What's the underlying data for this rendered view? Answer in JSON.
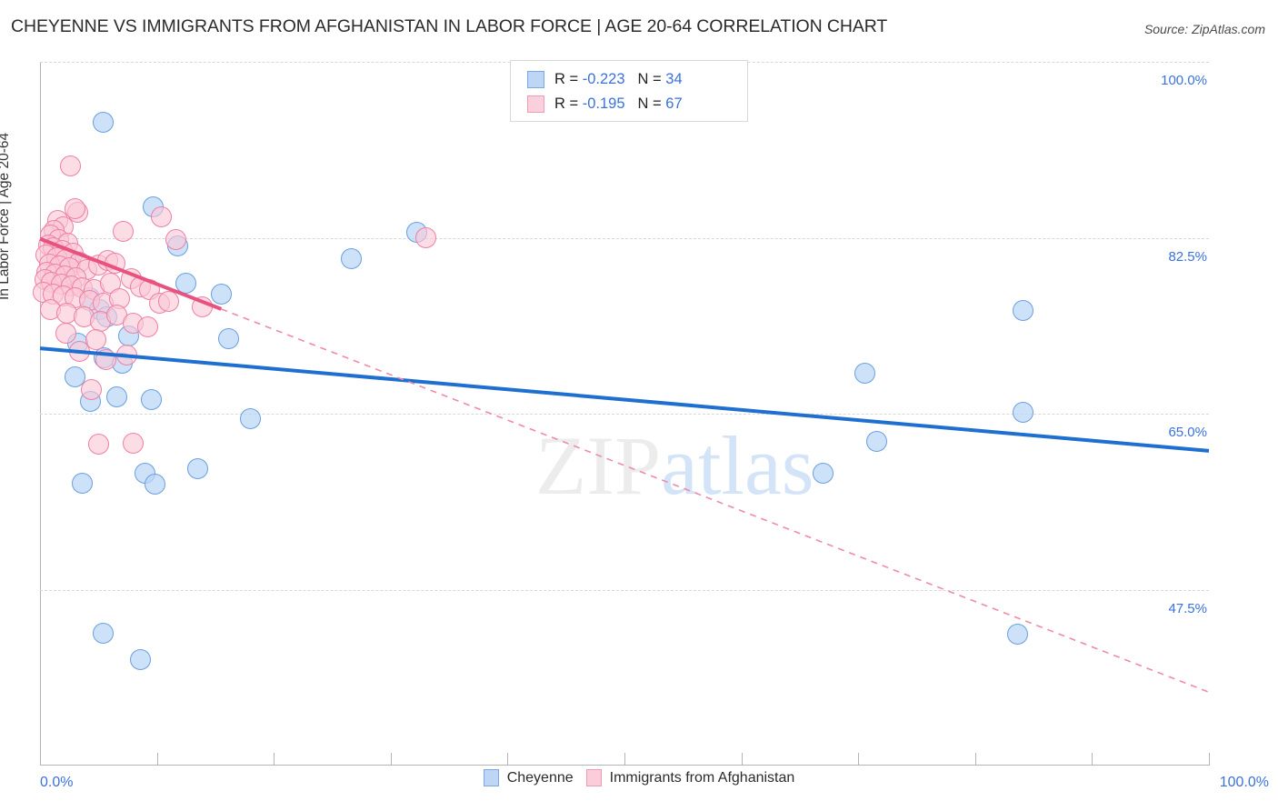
{
  "header": {
    "title": "CHEYENNE VS IMMIGRANTS FROM AFGHANISTAN IN LABOR FORCE | AGE 20-64 CORRELATION CHART",
    "source": "Source: ZipAtlas.com"
  },
  "watermark": {
    "part1": "ZIP",
    "part2": "atlas"
  },
  "stats_legend": {
    "rows": [
      {
        "series": "Cheyenne",
        "r_label": "R =",
        "r_value": "-0.223",
        "n_label": "N =",
        "n_value": "34",
        "color": "#bed6f5"
      },
      {
        "series": "Immigrants from Afghanistan",
        "r_label": "R =",
        "r_value": "-0.195",
        "n_label": "N =",
        "n_value": "67",
        "color": "#fad0dc"
      }
    ]
  },
  "series_legend": [
    {
      "label": "Cheyenne",
      "color": "#bed6f5"
    },
    {
      "label": "Immigrants from Afghanistan",
      "color": "#fbcdda"
    }
  ],
  "chart_data": {
    "type": "scatter",
    "title": "CHEYENNE VS IMMIGRANTS FROM AFGHANISTAN IN LABOR FORCE | AGE 20-64 CORRELATION CHART",
    "xlabel": "",
    "ylabel": "In Labor Force | Age 20-64",
    "xlim": [
      0,
      100
    ],
    "ylim": [
      30.0,
      100.0
    ],
    "grid": true,
    "legend_position": "bottom",
    "x_tick_labels": [
      "0.0%",
      "100.0%"
    ],
    "y_tick_labels": [
      "100.0%",
      "82.5%",
      "65.0%",
      "47.5%"
    ],
    "y_ticks": [
      100.0,
      82.5,
      65.0,
      47.5
    ],
    "series": [
      {
        "name": "Cheyenne",
        "color": "#bed6f5",
        "edge": "#6aa0de",
        "r": -0.223,
        "n": 34,
        "trend": {
          "style": "solid",
          "x0": 0,
          "y0": 71.5,
          "x1": 100,
          "y1": 61.3
        },
        "points": [
          [
            5.4,
            94.0
          ],
          [
            9.7,
            85.6
          ],
          [
            11.8,
            81.7
          ],
          [
            32.2,
            83.0
          ],
          [
            26.6,
            80.4
          ],
          [
            12.5,
            78.0
          ],
          [
            15.5,
            76.9
          ],
          [
            4.2,
            76.5
          ],
          [
            5.1,
            75.4
          ],
          [
            5.7,
            74.6
          ],
          [
            7.6,
            72.7
          ],
          [
            16.1,
            72.5
          ],
          [
            5.5,
            70.6
          ],
          [
            3.0,
            68.7
          ],
          [
            6.6,
            66.7
          ],
          [
            4.3,
            66.2
          ],
          [
            18.0,
            64.5
          ],
          [
            9.5,
            66.4
          ],
          [
            9.0,
            59.1
          ],
          [
            13.5,
            59.5
          ],
          [
            9.8,
            58.0
          ],
          [
            3.6,
            58.1
          ],
          [
            5.4,
            43.2
          ],
          [
            8.6,
            40.5
          ],
          [
            70.6,
            69.0
          ],
          [
            84.1,
            65.1
          ],
          [
            71.6,
            62.2
          ],
          [
            67.0,
            59.1
          ],
          [
            83.6,
            43.1
          ],
          [
            84.1,
            75.3
          ],
          [
            2.6,
            80.0
          ],
          [
            3.2,
            72.0
          ],
          [
            7.0,
            70.0
          ],
          [
            2.0,
            78.5
          ]
        ]
      },
      {
        "name": "Immigrants from Afghanistan",
        "color": "#fbcdda",
        "edge": "#ef7fa4",
        "r": -0.195,
        "n": 67,
        "trend": {
          "style": "solid-then-dashed",
          "x0": 0,
          "y0": 82.4,
          "x1": 100,
          "y1": 37.3,
          "solid_until_x": 15.5
        },
        "points": [
          [
            2.6,
            89.6
          ],
          [
            3.2,
            85.0
          ],
          [
            10.4,
            84.6
          ],
          [
            11.6,
            82.3
          ],
          [
            33.0,
            82.5
          ],
          [
            7.1,
            83.1
          ],
          [
            3.0,
            85.4
          ],
          [
            1.5,
            84.2
          ],
          [
            2.0,
            83.6
          ],
          [
            1.2,
            83.2
          ],
          [
            0.9,
            82.8
          ],
          [
            1.6,
            82.3
          ],
          [
            2.4,
            82.0
          ],
          [
            0.7,
            81.8
          ],
          [
            1.1,
            81.5
          ],
          [
            1.9,
            81.2
          ],
          [
            2.8,
            81.0
          ],
          [
            0.5,
            80.8
          ],
          [
            1.4,
            80.5
          ],
          [
            2.2,
            80.3
          ],
          [
            3.4,
            80.1
          ],
          [
            0.8,
            79.9
          ],
          [
            1.7,
            79.7
          ],
          [
            2.5,
            79.5
          ],
          [
            4.0,
            79.3
          ],
          [
            0.6,
            79.1
          ],
          [
            1.3,
            78.9
          ],
          [
            2.1,
            78.7
          ],
          [
            3.1,
            78.5
          ],
          [
            5.0,
            79.8
          ],
          [
            5.8,
            80.2
          ],
          [
            6.4,
            80.0
          ],
          [
            0.4,
            78.3
          ],
          [
            1.0,
            78.1
          ],
          [
            1.8,
            77.9
          ],
          [
            2.7,
            77.7
          ],
          [
            3.6,
            77.5
          ],
          [
            4.6,
            77.3
          ],
          [
            6.0,
            78.0
          ],
          [
            7.8,
            78.4
          ],
          [
            8.6,
            77.6
          ],
          [
            9.4,
            77.3
          ],
          [
            0.3,
            77.1
          ],
          [
            1.1,
            76.9
          ],
          [
            2.0,
            76.7
          ],
          [
            3.0,
            76.5
          ],
          [
            4.2,
            76.3
          ],
          [
            5.4,
            76.0
          ],
          [
            6.8,
            76.4
          ],
          [
            10.2,
            76.0
          ],
          [
            11.0,
            76.2
          ],
          [
            13.9,
            75.6
          ],
          [
            0.9,
            75.4
          ],
          [
            2.3,
            75.0
          ],
          [
            3.8,
            74.6
          ],
          [
            5.2,
            74.2
          ],
          [
            6.6,
            74.8
          ],
          [
            8.0,
            74.0
          ],
          [
            9.2,
            73.6
          ],
          [
            4.8,
            72.4
          ],
          [
            3.4,
            71.2
          ],
          [
            5.6,
            70.4
          ],
          [
            7.4,
            70.8
          ],
          [
            4.4,
            67.4
          ],
          [
            5.0,
            62.0
          ],
          [
            8.0,
            62.1
          ],
          [
            2.2,
            73.0
          ]
        ]
      }
    ]
  }
}
